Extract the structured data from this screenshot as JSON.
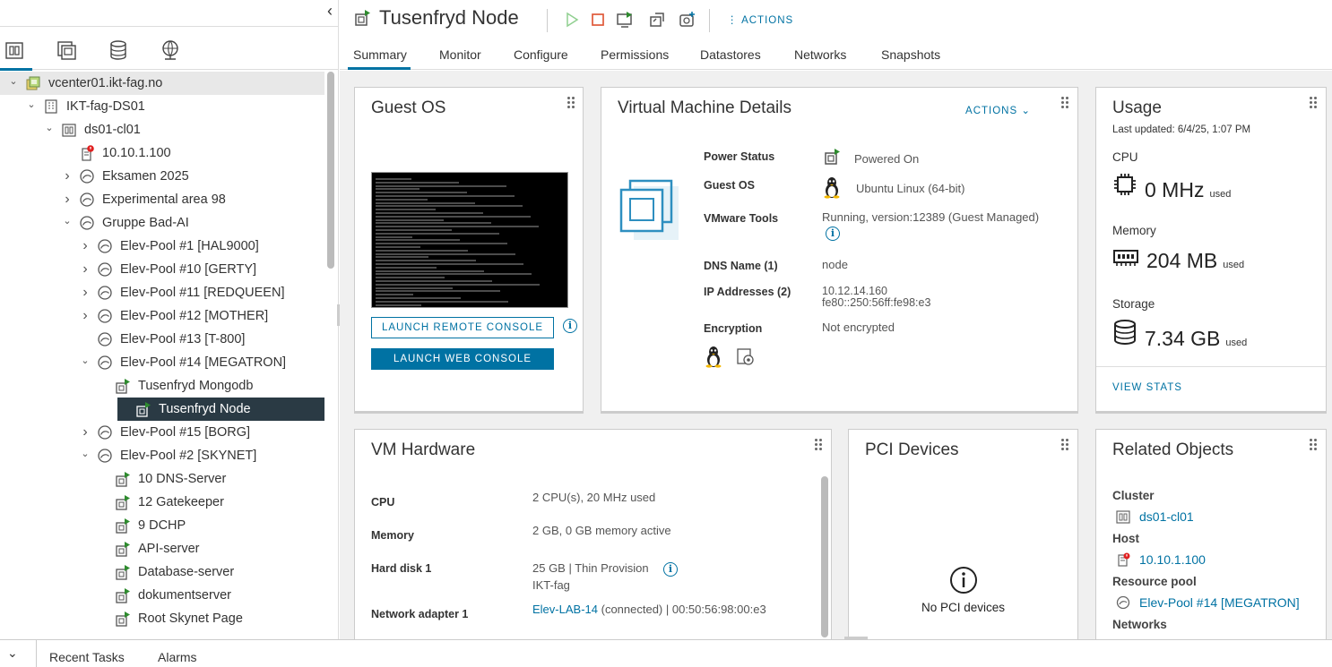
{
  "sidebar": {
    "tabs": [
      "hosts-and-clusters",
      "vms-and-templates",
      "storage",
      "networking"
    ],
    "tree": [
      {
        "label": "vcenter01.ikt-fag.no",
        "icon": "vcenter-icon",
        "level": 0,
        "chev": "v",
        "state": "selected"
      },
      {
        "label": "IKT-fag-DS01",
        "icon": "datacenter-icon",
        "level": 1,
        "chev": "v"
      },
      {
        "label": "ds01-cl01",
        "icon": "cluster-icon",
        "level": 2,
        "chev": "v"
      },
      {
        "label": "10.10.1.100",
        "icon": "host-alert-icon",
        "level": 3,
        "chev": ""
      },
      {
        "label": "Eksamen 2025",
        "icon": "resource-pool-icon",
        "level": 3,
        "chev": ">"
      },
      {
        "label": "Experimental area 98",
        "icon": "resource-pool-icon",
        "level": 3,
        "chev": ">"
      },
      {
        "label": "Gruppe Bad-AI",
        "icon": "resource-pool-icon",
        "level": 3,
        "chev": "v"
      },
      {
        "label": "Elev-Pool #1 [HAL9000]",
        "icon": "resource-pool-icon",
        "level": 4,
        "chev": ">"
      },
      {
        "label": "Elev-Pool #10 [GERTY]",
        "icon": "resource-pool-icon",
        "level": 4,
        "chev": ">"
      },
      {
        "label": "Elev-Pool #11 [REDQUEEN]",
        "icon": "resource-pool-icon",
        "level": 4,
        "chev": ">"
      },
      {
        "label": "Elev-Pool #12 [MOTHER]",
        "icon": "resource-pool-icon",
        "level": 4,
        "chev": ">"
      },
      {
        "label": "Elev-Pool #13 [T-800]",
        "icon": "resource-pool-icon",
        "level": 4,
        "chev": ""
      },
      {
        "label": "Elev-Pool #14 [MEGATRON]",
        "icon": "resource-pool-icon",
        "level": 4,
        "chev": "v"
      },
      {
        "label": "Tusenfryd Mongodb",
        "icon": "vm-on-icon",
        "level": 5,
        "chev": ""
      },
      {
        "label": "Tusenfryd Node",
        "icon": "vm-on-icon",
        "level": 5,
        "chev": "",
        "state": "active"
      },
      {
        "label": "Elev-Pool #15 [BORG]",
        "icon": "resource-pool-icon",
        "level": 4,
        "chev": ">"
      },
      {
        "label": "Elev-Pool #2 [SKYNET]",
        "icon": "resource-pool-icon",
        "level": 4,
        "chev": "v"
      },
      {
        "label": "10 DNS-Server",
        "icon": "vm-on-icon",
        "level": 5,
        "chev": ""
      },
      {
        "label": "12 Gatekeeper",
        "icon": "vm-on-icon",
        "level": 5,
        "chev": ""
      },
      {
        "label": "9 DCHP",
        "icon": "vm-on-icon",
        "level": 5,
        "chev": ""
      },
      {
        "label": "API-server",
        "icon": "vm-on-icon",
        "level": 5,
        "chev": ""
      },
      {
        "label": "Database-server",
        "icon": "vm-on-icon",
        "level": 5,
        "chev": ""
      },
      {
        "label": "dokumentserver",
        "icon": "vm-on-icon",
        "level": 5,
        "chev": ""
      },
      {
        "label": "Root Skynet Page",
        "icon": "vm-on-icon",
        "level": 5,
        "chev": ""
      }
    ]
  },
  "header": {
    "title": "Tusenfryd Node",
    "actions_label": "ACTIONS",
    "tabs": [
      "Summary",
      "Monitor",
      "Configure",
      "Permissions",
      "Datastores",
      "Networks",
      "Snapshots"
    ]
  },
  "guest_os": {
    "title": "Guest OS",
    "launch_remote": "LAUNCH REMOTE CONSOLE",
    "launch_web": "LAUNCH WEB CONSOLE"
  },
  "vm_details": {
    "title": "Virtual Machine Details",
    "actions_label": "ACTIONS",
    "power_status_label": "Power Status",
    "power_status_value": "Powered On",
    "guest_os_label": "Guest OS",
    "guest_os_value": "Ubuntu Linux (64-bit)",
    "vmware_tools_label": "VMware Tools",
    "vmware_tools_value": "Running, version:12389 (Guest Managed)",
    "dns_label": "DNS Name (1)",
    "dns_value": "node",
    "ip_label": "IP Addresses (2)",
    "ip_value_1": "10.12.14.160",
    "ip_value_2": "fe80::250:56ff:fe98:e3",
    "encryption_label": "Encryption",
    "encryption_value": "Not encrypted"
  },
  "usage": {
    "title": "Usage",
    "last_updated": "Last updated: 6/4/25, 1:07 PM",
    "cpu_label": "CPU",
    "cpu_value": "0 MHz",
    "memory_label": "Memory",
    "memory_value": "204 MB",
    "storage_label": "Storage",
    "storage_value": "7.34 GB",
    "used_suffix": "used",
    "view_stats": "VIEW STATS"
  },
  "vm_hardware": {
    "title": "VM Hardware",
    "cpu_label": "CPU",
    "cpu_value": "2 CPU(s), 20 MHz used",
    "memory_label": "Memory",
    "memory_value": "2 GB, 0 GB memory active",
    "disk_label": "Hard disk 1",
    "disk_value": "25 GB | Thin Provision",
    "disk_datastore": "IKT-fag",
    "net_label": "Network adapter 1",
    "net_link": "Elev-LAB-14",
    "net_rest": "(connected) | 00:50:56:98:00:e3"
  },
  "pci": {
    "title": "PCI Devices",
    "empty": "No PCI devices"
  },
  "related": {
    "title": "Related Objects",
    "cluster_label": "Cluster",
    "cluster_value": "ds01-cl01",
    "host_label": "Host",
    "host_value": "10.10.1.100",
    "pool_label": "Resource pool",
    "pool_value": "Elev-Pool #14 [MEGATRON]",
    "networks_label": "Networks"
  },
  "bottom": {
    "recent_tasks": "Recent Tasks",
    "alarms": "Alarms"
  },
  "colors": {
    "accent": "#0072a3",
    "selected_row": "#2a3a44",
    "vm_green": "#2e8b2e",
    "alert_red": "#e02020"
  }
}
